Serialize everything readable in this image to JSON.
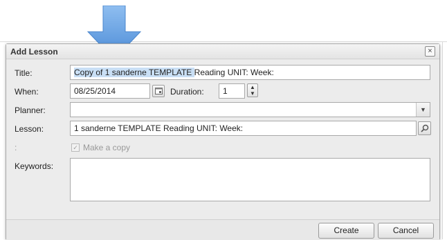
{
  "dialog": {
    "title": "Add Lesson",
    "close_glyph": "×"
  },
  "form": {
    "title_label": "Title:",
    "title_value_selected": "Copy of 1  sanderne  TEMPLATE ",
    "title_value_rest": "Reading   UNIT:    Week:",
    "when_label": "When:",
    "when_value": "08/25/2014",
    "duration_label": "Duration:",
    "duration_value": "1",
    "planner_label": "Planner:",
    "planner_value": "",
    "lesson_label": "Lesson:",
    "lesson_value": "1  sanderne  TEMPLATE  Reading   UNIT:    Week:",
    "copy_label": ":",
    "make_copy_label": "Make a copy",
    "make_copy_checked": true,
    "keywords_label": "Keywords:",
    "keywords_value": ""
  },
  "buttons": {
    "create": "Create",
    "cancel": "Cancel"
  },
  "colors": {
    "arrow": "#5b9be0",
    "selection": "#c9dff5"
  }
}
